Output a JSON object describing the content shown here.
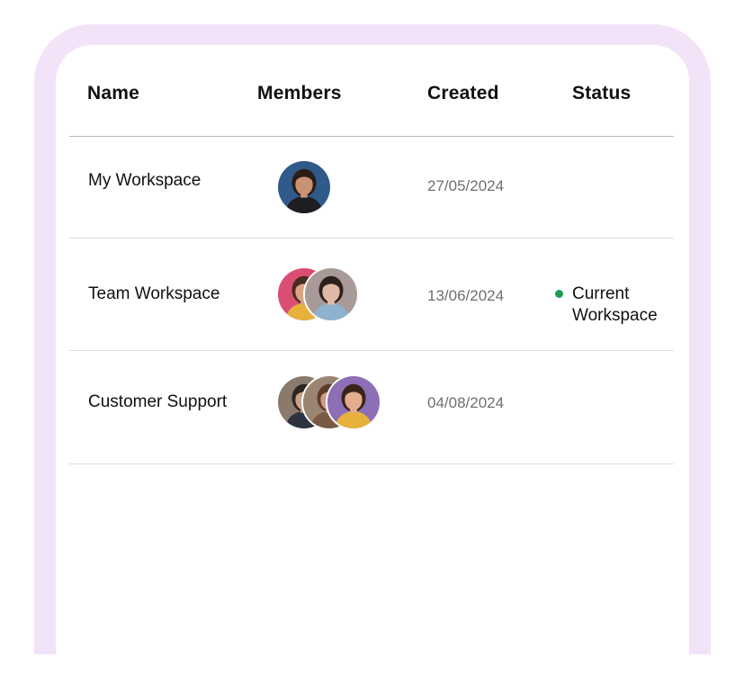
{
  "table": {
    "columns": [
      "Name",
      "Members",
      "Created",
      "Status"
    ],
    "rows": [
      {
        "name": "My Workspace",
        "created": "27/05/2024",
        "status": "",
        "members": [
          {
            "icon": "avatar-man-suit",
            "bg": "#2f5a8a",
            "skin": "#c89273",
            "hair": "#2a1d17",
            "shirt": "#1e1e22"
          }
        ]
      },
      {
        "name": "Team Workspace",
        "created": "13/06/2024",
        "status": "Current Workspace",
        "members": [
          {
            "icon": "avatar-woman-pink-bg",
            "bg": "#d84f73",
            "skin": "#d9a585",
            "hair": "#4a2b1d",
            "shirt": "#e7b13c"
          },
          {
            "icon": "avatar-woman-dark-hair",
            "bg": "#a89a98",
            "skin": "#e0b9a6",
            "hair": "#2c201c",
            "shirt": "#8fb2d0"
          }
        ]
      },
      {
        "name": "Customer Support",
        "created": "04/08/2024",
        "status": "",
        "members": [
          {
            "icon": "avatar-man-office",
            "bg": "#8a7a6c",
            "skin": "#c9a08a",
            "hair": "#2d2420",
            "shirt": "#2d3440"
          },
          {
            "icon": "avatar-woman-curly",
            "bg": "#9a8572",
            "skin": "#cf9c82",
            "hair": "#5c3b2a",
            "shirt": "#7a5a44"
          },
          {
            "icon": "avatar-woman-purple-bg",
            "bg": "#8d6fb5",
            "skin": "#e1ac8f",
            "hair": "#3a2419",
            "shirt": "#e7b13c"
          }
        ]
      }
    ]
  },
  "colors": {
    "frame": "#f3e3f8",
    "status_current": "#1f9d55"
  }
}
